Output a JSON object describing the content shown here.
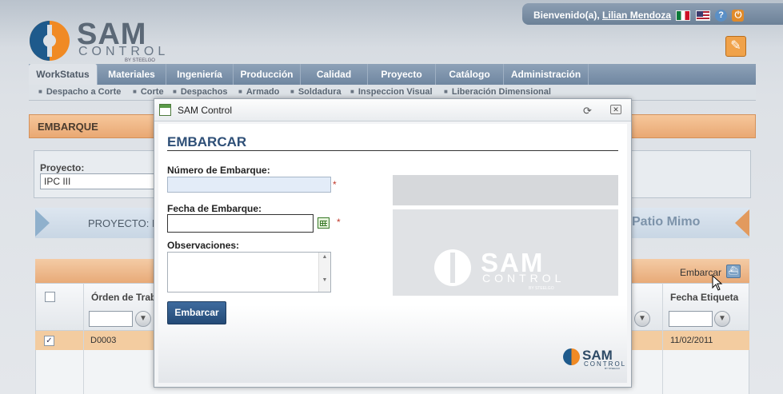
{
  "header": {
    "welcome_prefix": "Bienvenido(a),",
    "user_name": "Lilian Mendoza",
    "icons": [
      "flag-mexico-icon",
      "flag-usa-icon",
      "help-icon",
      "power-icon",
      "edit-icon"
    ]
  },
  "logo": {
    "line1": "SAM",
    "line2": "CONTROL",
    "line3": "BY STEELGO"
  },
  "nav": {
    "tabs": [
      "WorkStatus",
      "Materiales",
      "Ingeniería",
      "Producción",
      "Calidad",
      "Proyecto",
      "Catálogo",
      "Administración"
    ],
    "active": "WorkStatus",
    "subitems": [
      "Despacho a Corte",
      "Corte",
      "Despachos",
      "Armado",
      "Soldadura",
      "Inspeccion Visual",
      "Liberación Dimensional"
    ]
  },
  "page": {
    "section_title": "EMBARQUE",
    "project_label": "Proyecto:",
    "project_value": "IPC III",
    "banner_left": "PROYECTO: IP",
    "banner_right": "Patio Mimo",
    "embarcar_link": "Embarcar",
    "grid": {
      "columns": [
        "Órden de Trab",
        "Fecha Etiqueta"
      ],
      "rows": [
        {
          "checked": "✓",
          "orden": "D0003",
          "fecha": "11/02/2011"
        }
      ]
    }
  },
  "modal": {
    "title": "SAM Control",
    "form_title": "EMBARCAR",
    "numero_label": "Número de Embarque:",
    "numero_value": "",
    "fecha_label": "Fecha de Embarque:",
    "fecha_value": "",
    "observaciones_label": "Observaciones:",
    "observaciones_value": "",
    "required_mark": "*",
    "submit_label": "Embarcar"
  }
}
